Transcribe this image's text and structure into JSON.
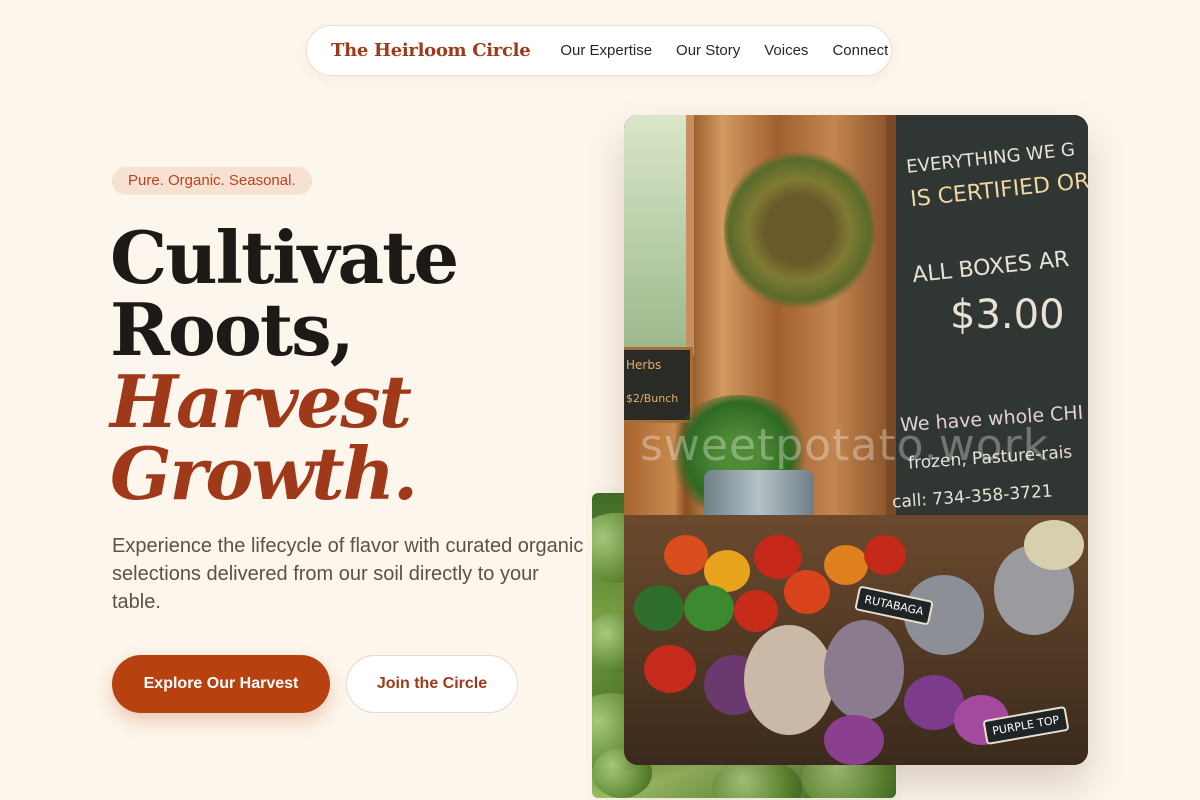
{
  "nav": {
    "brand": "The Heirloom Circle",
    "links": [
      "Our Expertise",
      "Our Story",
      "Voices",
      "Connect"
    ]
  },
  "hero": {
    "badge": "Pure. Organic. Seasonal.",
    "headline": [
      "Cultivate",
      "Roots,"
    ],
    "headline_accent": [
      "Harvest",
      "Growth."
    ],
    "description": "Experience the lifecycle of flavor with curated organic selections delivered from our soil directly to your table.",
    "primary_cta": "Explore Our Harvest",
    "secondary_cta": "Join the Circle"
  },
  "photo": {
    "board_lines": [
      "EVERYTHING WE G",
      "IS CERTIFIED OR",
      "ALL BOXES AR",
      "$3.00",
      "We have whole CHI",
      "frozen, Pasture-rais",
      "call: 734-358-3721"
    ],
    "mini_board": [
      "Herbs",
      "$2/Bunch"
    ],
    "tags": [
      "RUTABAGA",
      "PURPLE TOP"
    ],
    "watermark": "sweetpotato.work"
  },
  "colors": {
    "background": "#fdf6ec",
    "accent": "#b8420f",
    "brand": "#9c3b19",
    "headline": "#1c1a17"
  }
}
